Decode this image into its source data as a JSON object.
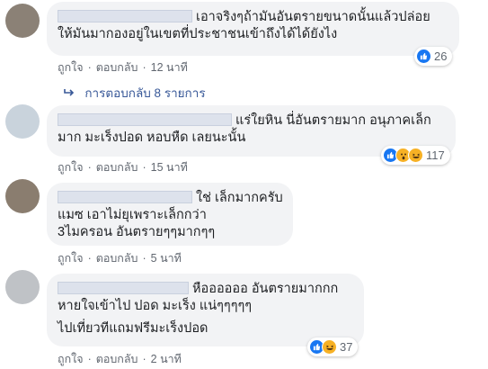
{
  "colors": {
    "bubble": "#f2f3f5",
    "like": "#1877f2",
    "haha": "#f7b125",
    "wow": "#f7b125",
    "link": "#385898"
  },
  "actions": {
    "like_label": "ถูกใจ",
    "reply_label": "ตอบกลับ",
    "separator": "·"
  },
  "replies_link": {
    "icon": "reply-arrow-icon",
    "label": "การตอบกลับ 8 รายการ"
  },
  "comments": [
    {
      "lines": [
        "เอาจริงๆถ้ามันอันตรายขนาดนั้นแล้วปล่อย",
        "ให้มันมากองอยู่ในเขตที่ประชาชนเข้าถึงได้ได้ยังไง"
      ],
      "time": "12 นาที",
      "reactions": [
        "like"
      ],
      "reaction_count": "26"
    },
    {
      "lines": [
        "แร่ใยหิน นี่อันตรายมาก อนุภาคเล็ก",
        "มาก มะเร็งปอด หอบหืด เลยนะนั้น"
      ],
      "time": "15 นาที",
      "reactions": [
        "like",
        "wow",
        "haha"
      ],
      "reaction_count": "117"
    },
    {
      "lines": [
        "ใช่ เล็กมากครับ",
        "แมซ เอาไม่ยุเพราะเล็กกว่า",
        "3ไมครอน อันตรายๆๆมากๆๆ"
      ],
      "time": "5 นาที",
      "reactions": [],
      "reaction_count": ""
    },
    {
      "lines": [
        "หืออออออ อันตรายมากกก",
        "หายใจเข้าไป ปอด มะเร็ง แน่ๆๆๆๆๆ",
        "ไปเที่ยวทีแถมฟรีมะเร็งปอด"
      ],
      "time": "2 นาที",
      "reactions": [
        "like",
        "haha"
      ],
      "reaction_count": "37"
    }
  ]
}
